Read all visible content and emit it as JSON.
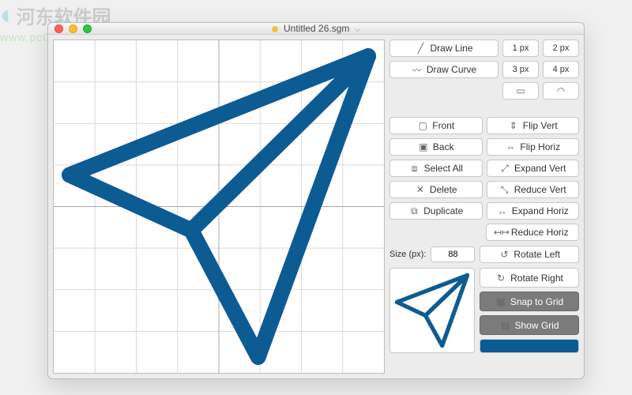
{
  "watermark": {
    "zh": "河东软件园",
    "url": "www.pc0359.cn"
  },
  "window": {
    "title": "Untitled 26.sgm"
  },
  "tools": {
    "draw_line": "Draw Line",
    "draw_curve": "Draw Curve",
    "px1": "1 px",
    "px2": "2 px",
    "px3": "3 px",
    "px4": "4 px"
  },
  "layer": {
    "front": "Front",
    "back": "Back",
    "select_all": "Select All",
    "delete": "Delete",
    "duplicate": "Duplicate"
  },
  "transform": {
    "flip_vert": "Flip Vert",
    "flip_horiz": "Flip Horiz",
    "expand_vert": "Expand Vert",
    "reduce_vert": "Reduce Vert",
    "expand_horiz": "Expand Horiz",
    "reduce_horiz": "Reduce Horiz",
    "rotate_left": "Rotate Left",
    "rotate_right": "Rotate Right"
  },
  "size": {
    "label": "Size (px):",
    "value": "88"
  },
  "view": {
    "snap": "Snap to Grid",
    "show_grid": "Show Grid"
  },
  "canvas": {
    "shape_color": "#0d5b93"
  }
}
